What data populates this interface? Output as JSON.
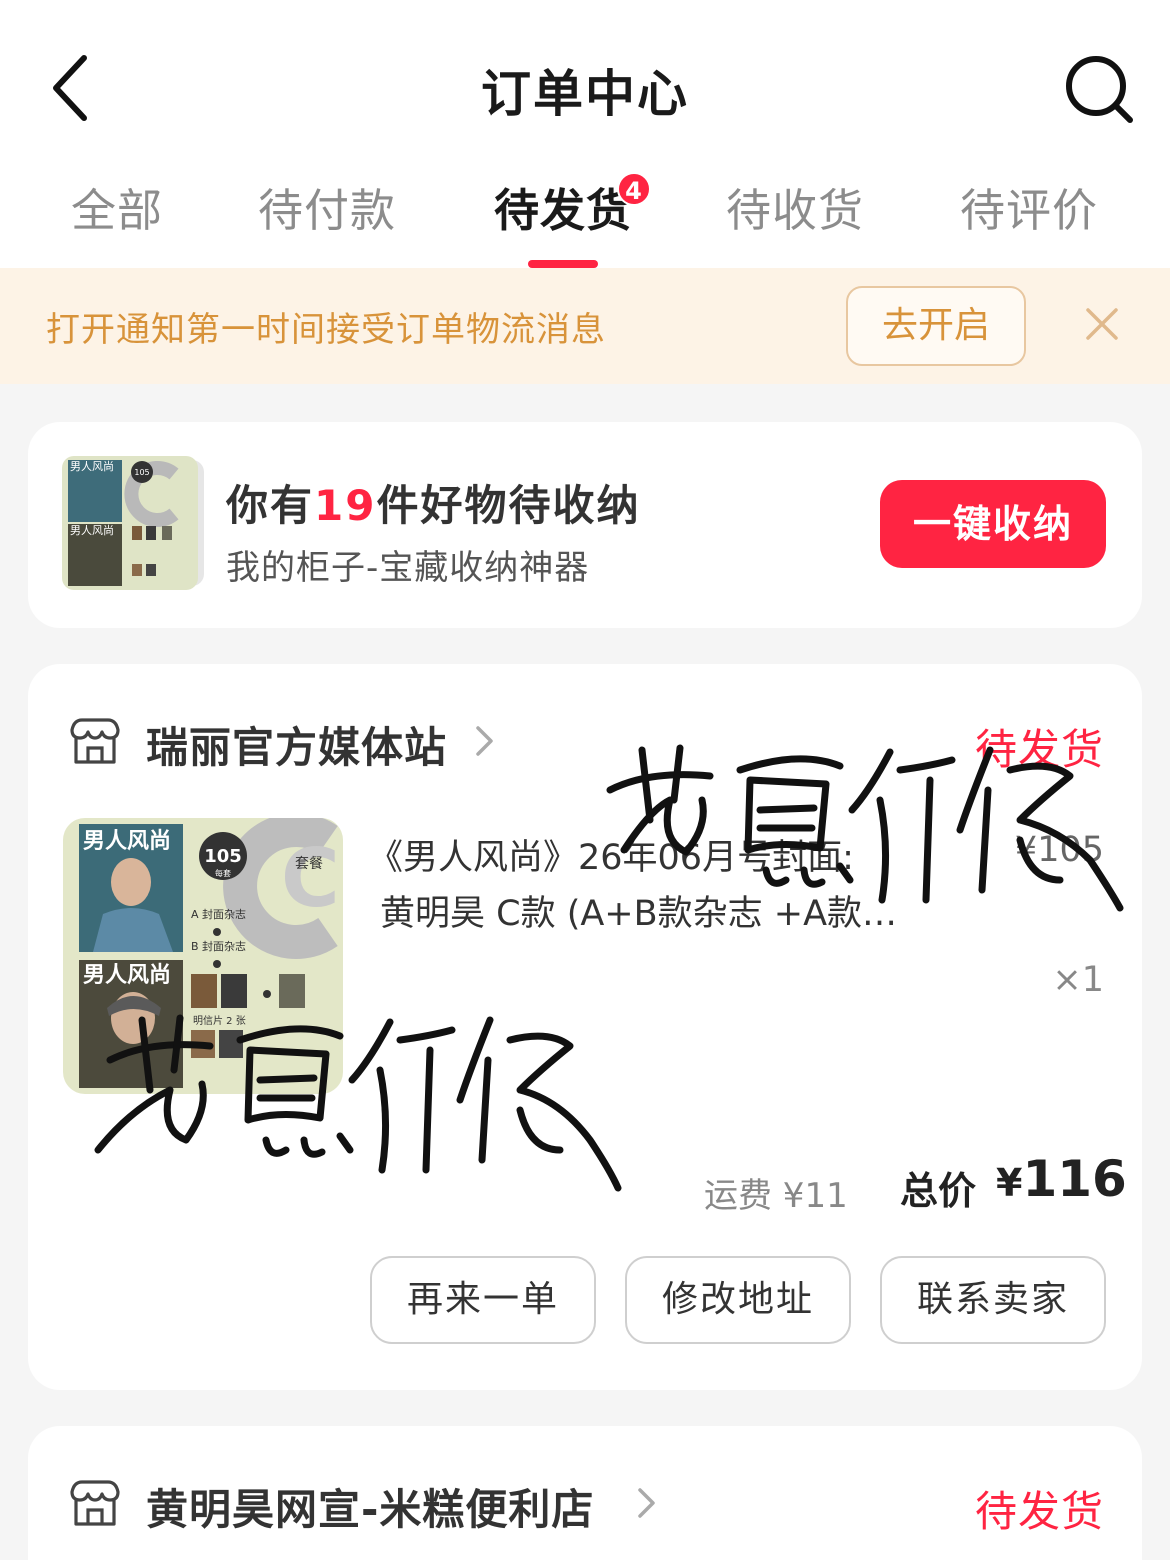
{
  "header": {
    "title": "订单中心",
    "back_icon": "chevron-left-icon",
    "search_icon": "search-icon"
  },
  "tabs": [
    {
      "label": "全部",
      "active": false
    },
    {
      "label": "待付款",
      "active": false
    },
    {
      "label": "待发货",
      "active": true,
      "badge": "4"
    },
    {
      "label": "待收货",
      "active": false
    },
    {
      "label": "待评价",
      "active": false
    }
  ],
  "notice": {
    "text": "打开通知第一时间接受订单物流消息",
    "button": "去开启",
    "close_icon": "close-icon"
  },
  "promo": {
    "title_prefix": "你有",
    "count": "19",
    "title_suffix": "件好物待收纳",
    "subtitle": "我的柜子-宝藏收纳神器",
    "button": "一键收纳",
    "thumb_cover_text": "男人风尚",
    "thumb_price_badge": "105"
  },
  "orders": [
    {
      "shop_name": "瑞丽官方媒体站",
      "status": "待发货",
      "product": {
        "title_line1": "《男人风尚》26年06月号封面:",
        "title_line2": "黄明昊 C款 (A+B款杂志 +A款…",
        "price": "¥105",
        "quantity": "×1",
        "image": {
          "cover_title": "男人风尚",
          "letter": "C",
          "price_badge": "105",
          "price_unit": "元",
          "badge_sub": "每套",
          "package_label": "套餐",
          "item_a": "A 封面杂志",
          "item_b": "B 封面杂志",
          "bottom_label": "明信片 2 张"
        }
      },
      "shipping_fee": "运费 ¥11",
      "total_label": "总价",
      "total_currency": "¥",
      "total_amount": "116",
      "actions": [
        "再来一单",
        "修改地址",
        "联系卖家"
      ]
    },
    {
      "shop_name": "黄明昊网宣-米糕便利店",
      "status": "待发货"
    }
  ],
  "colors": {
    "accent": "#ff2442",
    "notice_bg": "#fdf3e6",
    "notice_text": "#d8933a",
    "page_bg": "#f5f5f5"
  }
}
